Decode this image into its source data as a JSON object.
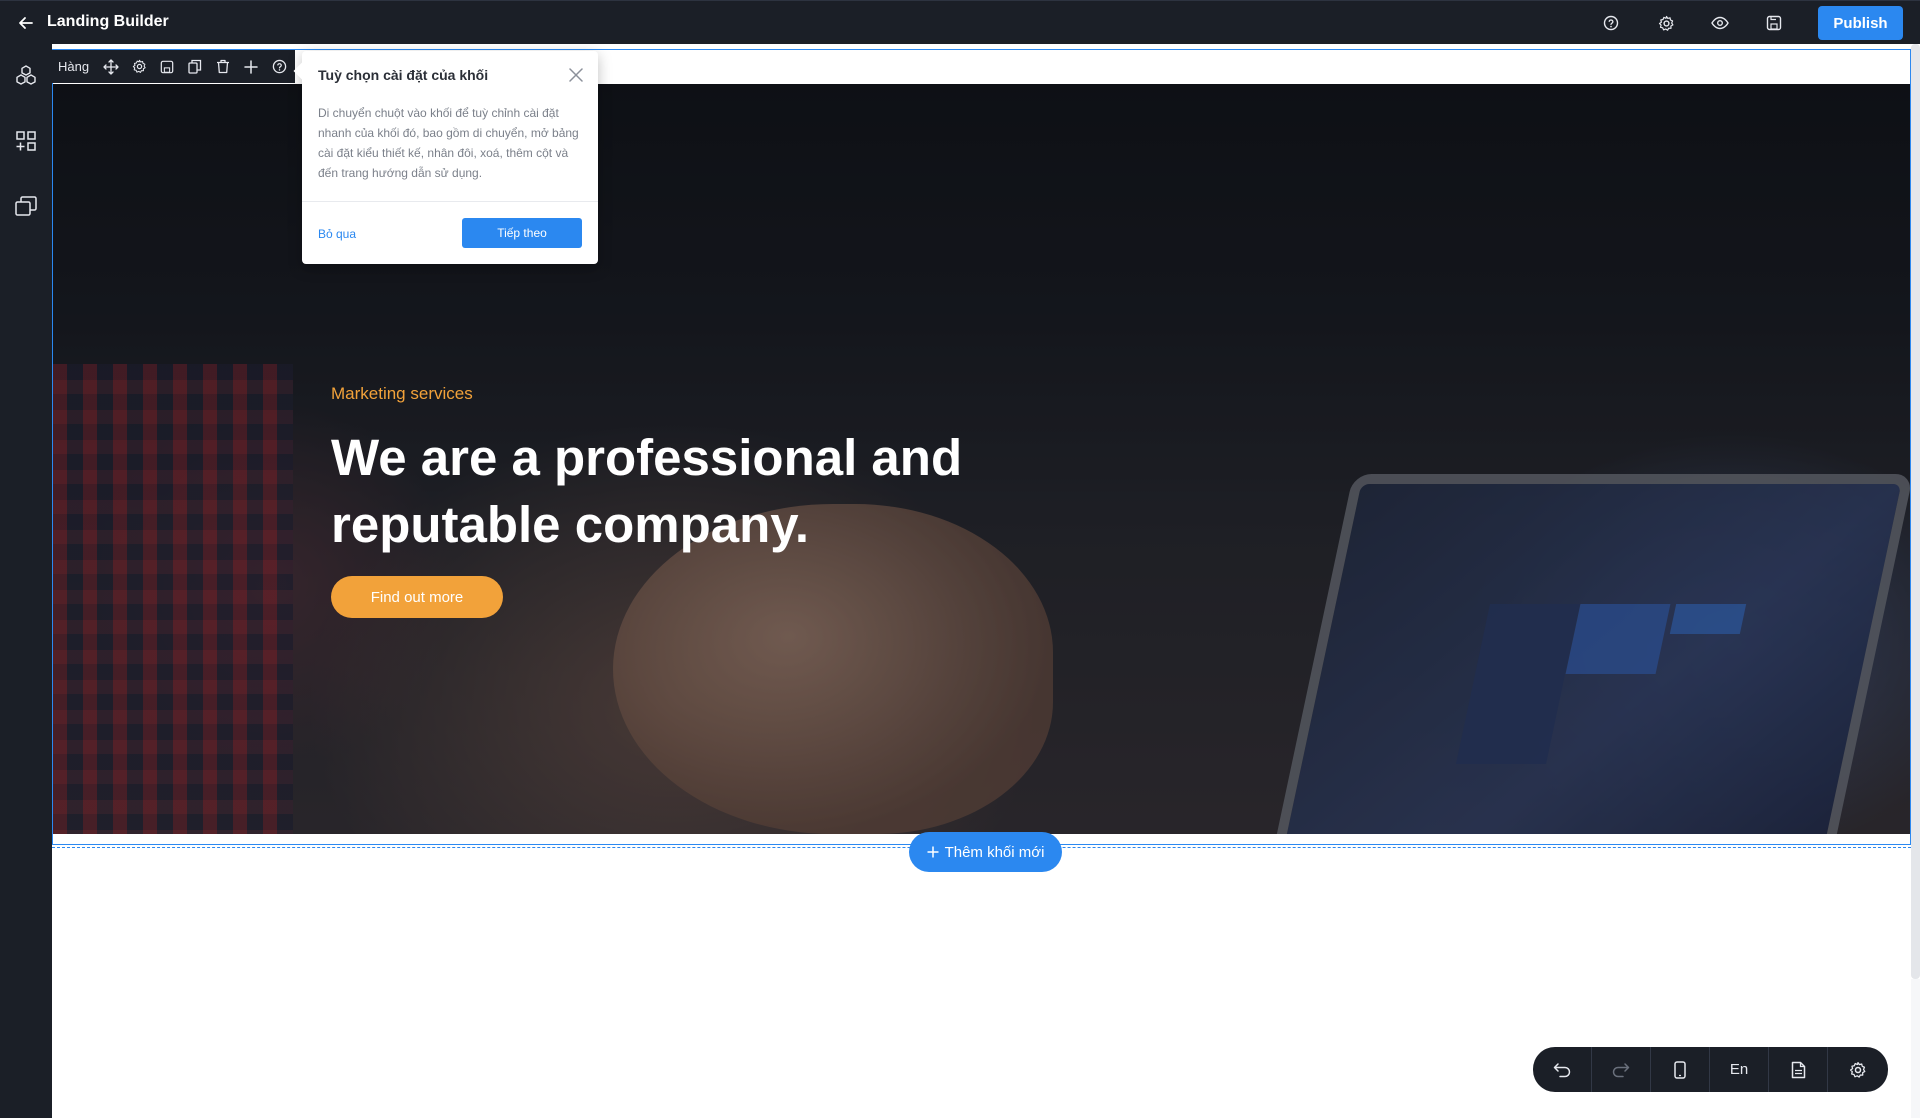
{
  "app": {
    "title": "Landing Builder",
    "publish_label": "Publish"
  },
  "topbar_icons": [
    "help-icon",
    "settings-icon",
    "preview-eye-icon",
    "save-icon"
  ],
  "leftrail_icons": [
    "blocks-icon",
    "add-widget-icon",
    "pages-icon"
  ],
  "row_toolbar": {
    "label": "Hàng",
    "icons": [
      "move-icon",
      "settings-icon",
      "save-icon",
      "duplicate-icon",
      "delete-icon",
      "add-icon",
      "help-icon"
    ]
  },
  "popover": {
    "title": "Tuỳ chọn cài đặt của khối",
    "body": "Di chuyển chuột vào khối để tuỳ chỉnh cài đặt nhanh của khối đó, bao gồm di chuyển, mở bảng cài đặt kiểu thiết kế, nhân đôi, xoá, thêm cột và đến trang hướng dẫn sử dụng.",
    "skip_label": "Bỏ qua",
    "next_label": "Tiếp theo"
  },
  "hero": {
    "subtitle": "Marketing services",
    "title": "We are a professional and reputable company.",
    "cta_label": "Find out more"
  },
  "add_block_label": "Thêm khối mới",
  "bottom_toolbar": {
    "language": "En",
    "icons": [
      "undo-icon",
      "redo-icon",
      "mobile-view-icon",
      "language",
      "page-icon",
      "settings-icon"
    ]
  },
  "colors": {
    "accent": "#2b88f0",
    "hero_accent": "#f2a23a",
    "chrome": "#1b1f27"
  }
}
